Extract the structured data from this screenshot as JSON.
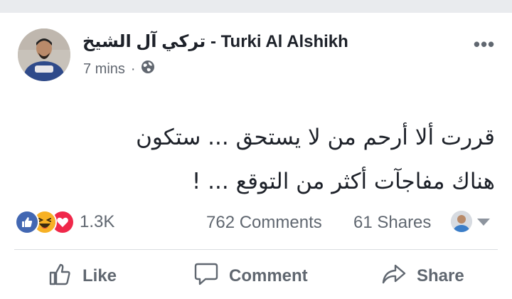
{
  "post": {
    "author": "تركي آل الشيخ - Turki Al Alshikh",
    "time": "7 mins",
    "dot": "·",
    "more": "•••",
    "text_lines": [
      "قررت ألا أرحم  من لا يستحق ... ستكون",
      "هناك مفاجآت  أكثر من التوقع ... !"
    ]
  },
  "stats": {
    "reactions_count": "1.3K",
    "comments": "762 Comments",
    "shares": "61 Shares"
  },
  "actions": {
    "like": "Like",
    "comment": "Comment",
    "share": "Share"
  },
  "icons": {
    "privacy": "globe-icon",
    "like_reaction": "like-reaction-icon",
    "haha_reaction": "haha-reaction-icon",
    "love_reaction": "love-reaction-icon",
    "like_action": "thumbs-up-icon",
    "comment_action": "comment-bubble-icon",
    "share_action": "share-arrow-icon"
  },
  "colors": {
    "text": "#1d2129",
    "secondary": "#606770",
    "like_blue": "#4267b2",
    "love_red": "#f0284a",
    "haha_yellow": "#f7b125"
  }
}
